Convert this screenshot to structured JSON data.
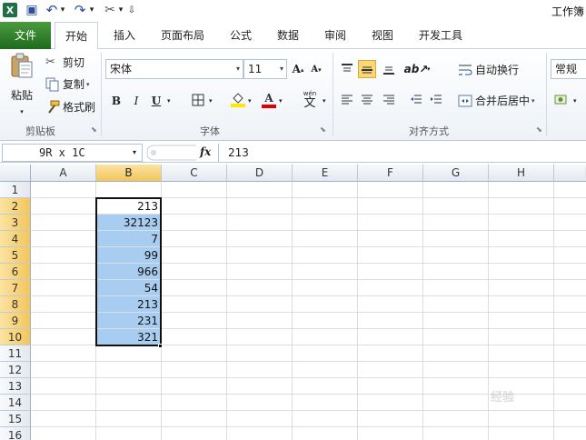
{
  "app": {
    "title": "工作簿",
    "qat": [
      {
        "name": "excel-logo-icon",
        "glyph": "X",
        "color": "#1e7145"
      },
      {
        "name": "save-icon",
        "glyph": "▣",
        "color": "#2b4f9e"
      },
      {
        "name": "undo-icon",
        "glyph": "↶",
        "color": "#2b4f9e"
      },
      {
        "name": "undo-dropdown-icon",
        "glyph": "▾",
        "color": "#333"
      },
      {
        "name": "redo-icon",
        "glyph": "↷",
        "color": "#2b4f9e"
      },
      {
        "name": "redo-dropdown-icon",
        "glyph": "▾",
        "color": "#333"
      },
      {
        "name": "tools-icon",
        "glyph": "✂",
        "color": "#555"
      },
      {
        "name": "tools-dropdown-icon",
        "glyph": "▾",
        "color": "#333"
      },
      {
        "name": "customize-qat-icon",
        "glyph": "⇩",
        "color": "#333"
      }
    ]
  },
  "tabs": {
    "file": "文件",
    "home": "开始",
    "insert": "插入",
    "layout": "页面布局",
    "formulas": "公式",
    "data": "数据",
    "review": "审阅",
    "view": "视图",
    "developer": "开发工具"
  },
  "ribbon": {
    "clipboard": {
      "label": "剪贴板",
      "paste": "粘贴",
      "cut": "剪切",
      "copy": "复制",
      "format_painter": "格式刷"
    },
    "font": {
      "label": "字体",
      "font_name": "宋体",
      "font_size": "11",
      "grow": "A",
      "shrink": "A",
      "bold": "B",
      "italic": "I",
      "underline": "U",
      "font_color_letter": "A",
      "phonetic": "wén",
      "phonetic_char": "文",
      "fill_color": "#ffe600",
      "font_color": "#e00000"
    },
    "alignment": {
      "label": "对齐方式",
      "wrap_text": "自动换行",
      "merge_center": "合并后居中"
    },
    "number": {
      "format": "常规"
    }
  },
  "formula_bar": {
    "name_box": "9R x 1C",
    "fx": "fx",
    "value": "213"
  },
  "sheet": {
    "columns": [
      "A",
      "B",
      "C",
      "D",
      "E",
      "F",
      "G",
      "H",
      "I"
    ],
    "rows": [
      "1",
      "2",
      "3",
      "4",
      "5",
      "6",
      "7",
      "8",
      "9",
      "10",
      "11",
      "12",
      "13",
      "14",
      "15",
      "16"
    ],
    "selected_column": "B",
    "selected_rows": [
      "2",
      "3",
      "4",
      "5",
      "6",
      "7",
      "8",
      "9",
      "10"
    ],
    "column_b_values": [
      "213",
      "32123",
      "7",
      "99",
      "966",
      "54",
      "213",
      "231",
      "321"
    ],
    "selection_color": "#a8cdf0"
  },
  "watermark": "经验"
}
